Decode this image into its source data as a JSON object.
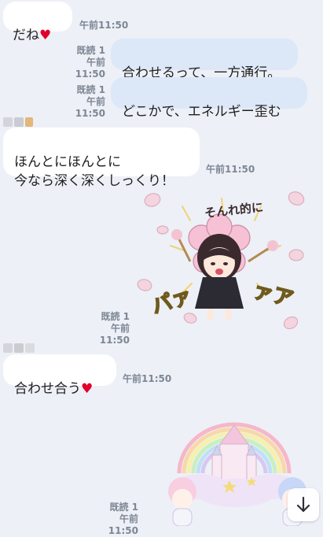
{
  "messages": [
    {
      "id": "m1",
      "side": "in",
      "text": "だね",
      "heart": "♥",
      "time": "午前11:50"
    },
    {
      "id": "m2",
      "side": "out",
      "text": "合わせるって、一方通行。",
      "read": "既読 1",
      "time": "午前11:50"
    },
    {
      "id": "m3",
      "side": "out",
      "text": "どこかで、エネルギー歪む",
      "read": "既読 1",
      "time": "午前11:50"
    },
    {
      "id": "m4",
      "side": "in",
      "text": "ほんとにほんとに\n今なら深く深くしっくり！",
      "time": "午前11:50"
    },
    {
      "id": "m5",
      "side": "out",
      "type": "sticker",
      "sticker_text_top": "そんれ的に",
      "sticker_text_left": "パァ",
      "sticker_text_right": "ァア",
      "read": "既読 1",
      "time": "午前11:50"
    },
    {
      "id": "m6",
      "side": "in",
      "text": "合わせ合う",
      "heart": "♥",
      "time": "午前11:50"
    },
    {
      "id": "m7",
      "side": "out",
      "type": "sticker",
      "read": "既読 1",
      "time": "午前11:50"
    }
  ],
  "icons": {
    "heart": "heart-icon",
    "scroll": "arrow-down-icon"
  },
  "colors": {
    "background": "#edf0f6",
    "incoming_bubble": "#ffffff",
    "outgoing_bubble": "#dce8f8",
    "heart": "#e1002c",
    "meta_text": "#7d8694"
  }
}
